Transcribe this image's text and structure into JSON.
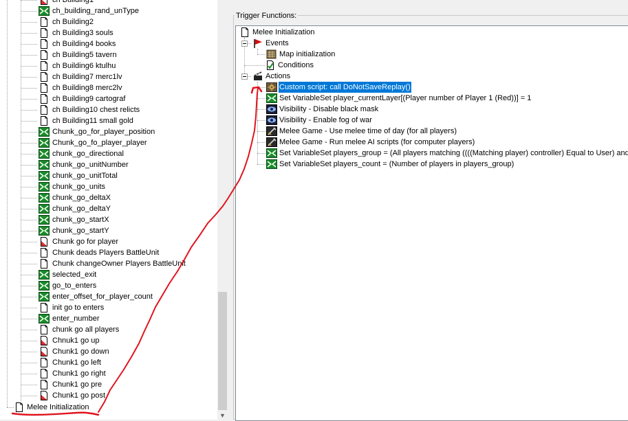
{
  "left_tree": {
    "items": [
      {
        "label": "ch Building1",
        "icon": "trigger-disabled-icon"
      },
      {
        "label": "ch_building_rand_unType",
        "icon": "variable-icon"
      },
      {
        "label": "ch Building2",
        "icon": "trigger-icon"
      },
      {
        "label": "ch Building3 souls",
        "icon": "trigger-icon"
      },
      {
        "label": "ch Building4 books",
        "icon": "trigger-icon"
      },
      {
        "label": "ch Building5 tavern",
        "icon": "trigger-icon"
      },
      {
        "label": "ch Building6 ktulhu",
        "icon": "trigger-icon"
      },
      {
        "label": "ch Building7 merc1lv",
        "icon": "trigger-icon"
      },
      {
        "label": "ch Building8 merc2lv",
        "icon": "trigger-icon"
      },
      {
        "label": "ch Building9 cartograf",
        "icon": "trigger-icon"
      },
      {
        "label": "ch Building10 chest relicts",
        "icon": "trigger-icon"
      },
      {
        "label": "ch Building11 small gold",
        "icon": "trigger-icon"
      },
      {
        "label": "Chunk_go_for_player_position",
        "icon": "variable-icon"
      },
      {
        "label": "Chunk_go_fo_player_player",
        "icon": "variable-icon"
      },
      {
        "label": "chunk_go_directional",
        "icon": "variable-icon"
      },
      {
        "label": "chunk_go_unitNumber",
        "icon": "variable-icon"
      },
      {
        "label": "chunk_go_unitTotal",
        "icon": "variable-icon"
      },
      {
        "label": "chunk_go_units",
        "icon": "variable-icon"
      },
      {
        "label": "chunk_go_deltaX",
        "icon": "variable-icon"
      },
      {
        "label": "chunk_go_deltaY",
        "icon": "variable-icon"
      },
      {
        "label": "chunk_go_startX",
        "icon": "variable-icon"
      },
      {
        "label": "chunk_go_startY",
        "icon": "variable-icon"
      },
      {
        "label": "Chunk go for player",
        "icon": "trigger-disabled-icon"
      },
      {
        "label": "Chunk deads Players BattleUnit",
        "icon": "trigger-icon"
      },
      {
        "label": "Chunk changeOwner Players BattleUnit",
        "icon": "trigger-icon"
      },
      {
        "label": "selected_exit",
        "icon": "variable-icon"
      },
      {
        "label": "go_to_enters",
        "icon": "variable-icon"
      },
      {
        "label": "enter_offset_for_player_count",
        "icon": "variable-icon"
      },
      {
        "label": "init go to enters",
        "icon": "trigger-icon"
      },
      {
        "label": "enter_number",
        "icon": "variable-icon"
      },
      {
        "label": "chunk go all players",
        "icon": "trigger-icon"
      },
      {
        "label": "Chnuk1 go up",
        "icon": "trigger-disabled-icon"
      },
      {
        "label": "Chunk1 go down",
        "icon": "trigger-disabled-icon"
      },
      {
        "label": "Chunk1 go left",
        "icon": "trigger-icon"
      },
      {
        "label": "Chunk1 go right",
        "icon": "trigger-icon"
      },
      {
        "label": "Chunk1 go pre",
        "icon": "trigger-icon"
      },
      {
        "label": "Chunk1 go post",
        "icon": "trigger-disabled-icon"
      }
    ],
    "root_item": {
      "label": "Melee Initialization",
      "icon": "trigger-icon"
    }
  },
  "trigger_functions": {
    "title": "Trigger Functions:",
    "root": {
      "label": "Melee Initialization",
      "icon": "trigger-icon"
    },
    "events": {
      "label": "Events",
      "icon": "event-flag-icon"
    },
    "event_items": [
      {
        "label": "Map initialization",
        "icon": "map-icon"
      }
    ],
    "conditions": {
      "label": "Conditions",
      "icon": "condition-icon"
    },
    "actions": {
      "label": "Actions",
      "icon": "action-icon"
    },
    "action_items": [
      {
        "label": "Custom script:   call DoNotSaveReplay()",
        "icon": "custom-script-icon",
        "selected": true
      },
      {
        "label": "Set VariableSet player_currentLayer[(Player number of Player 1 (Red))] = 1",
        "icon": "set-variable-icon"
      },
      {
        "label": "Visibility - Disable black mask",
        "icon": "visibility-icon"
      },
      {
        "label": "Visibility - Enable fog of war",
        "icon": "visibility-icon"
      },
      {
        "label": "Melee Game - Use melee time of day (for all players)",
        "icon": "melee-game-icon"
      },
      {
        "label": "Melee Game - Run melee AI scripts (for computer players)",
        "icon": "melee-game-icon"
      },
      {
        "label": "Set VariableSet players_group = (All players matching ((((Matching player) controller) Equal to User) and (((Ma",
        "icon": "set-variable-icon"
      },
      {
        "label": "Set VariableSet players_count = (Number of players in players_group)",
        "icon": "set-variable-icon"
      }
    ]
  },
  "colors": {
    "selection": "#0078d7",
    "annotation": "#e0141e",
    "variable_icon": "#1a8a2a",
    "flag": "#d01010"
  }
}
